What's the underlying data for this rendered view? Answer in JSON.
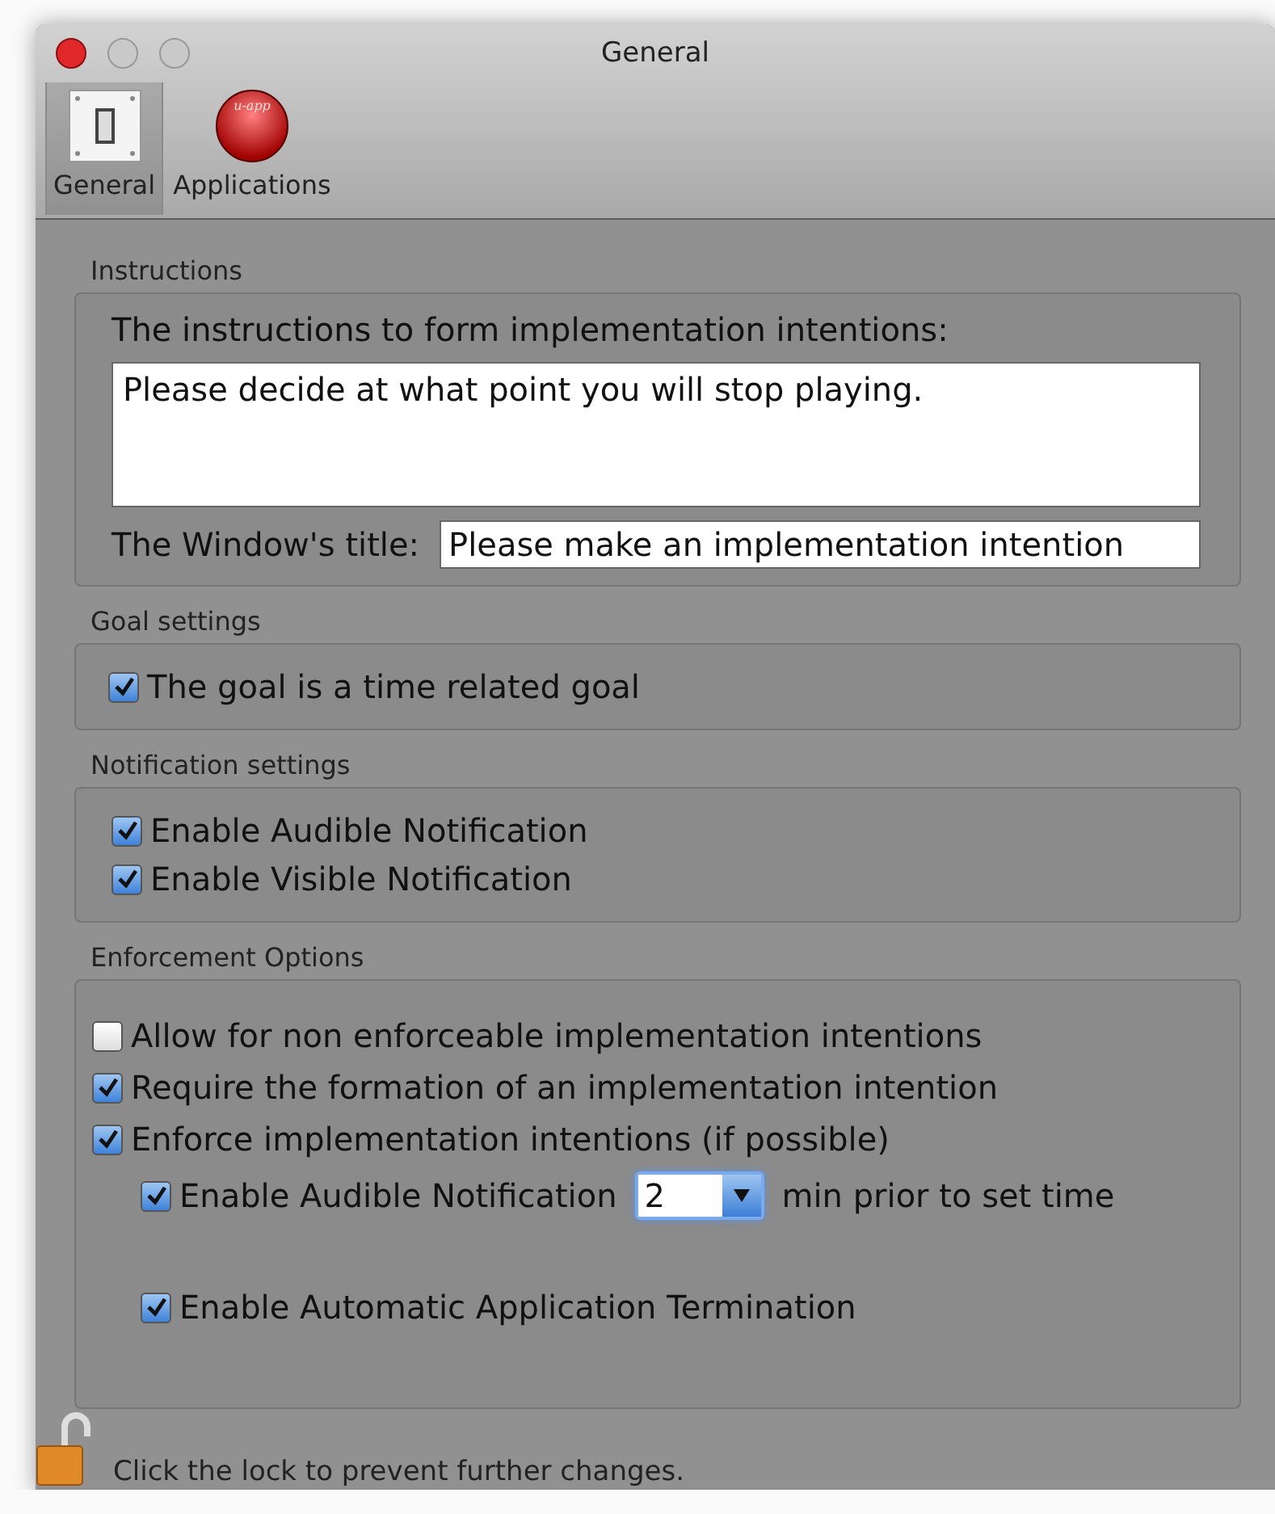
{
  "window": {
    "title": "General"
  },
  "toolbar": [
    {
      "label": "General",
      "selected": true,
      "kind": "switch"
    },
    {
      "label": "Applications",
      "selected": false,
      "kind": "ball",
      "icon_text": "u-app"
    }
  ],
  "instructions": {
    "heading": "Instructions",
    "prompt": "The instructions to form implementation intentions:",
    "text": "Please decide at what point you will stop playing.",
    "title_label": "The Window's title:",
    "title_value": "Please make an implementation intention"
  },
  "goal_settings": {
    "heading": "Goal settings",
    "items": [
      {
        "label": "The goal is a time related goal",
        "checked": true
      }
    ]
  },
  "notification_settings": {
    "heading": "Notification settings",
    "items": [
      {
        "label": "Enable Audible Notification",
        "checked": true
      },
      {
        "label": "Enable Visible Notification",
        "checked": true
      }
    ]
  },
  "enforcement_options": {
    "heading": "Enforcement Options",
    "items": [
      {
        "label": "Allow for non enforceable implementation intentions",
        "checked": false
      },
      {
        "label": "Require the formation of an implementation intention",
        "checked": true
      },
      {
        "label": "Enforce implementation intentions (if possible)",
        "checked": true,
        "children": [
          {
            "label": "Enable Audible Notification",
            "checked": true,
            "select_value": "2",
            "suffix": "min prior to set time"
          },
          {
            "label": "Enable Automatic Application Termination",
            "checked": true
          }
        ]
      }
    ]
  },
  "status_bar": {
    "text": "Click the lock to prevent further changes."
  }
}
